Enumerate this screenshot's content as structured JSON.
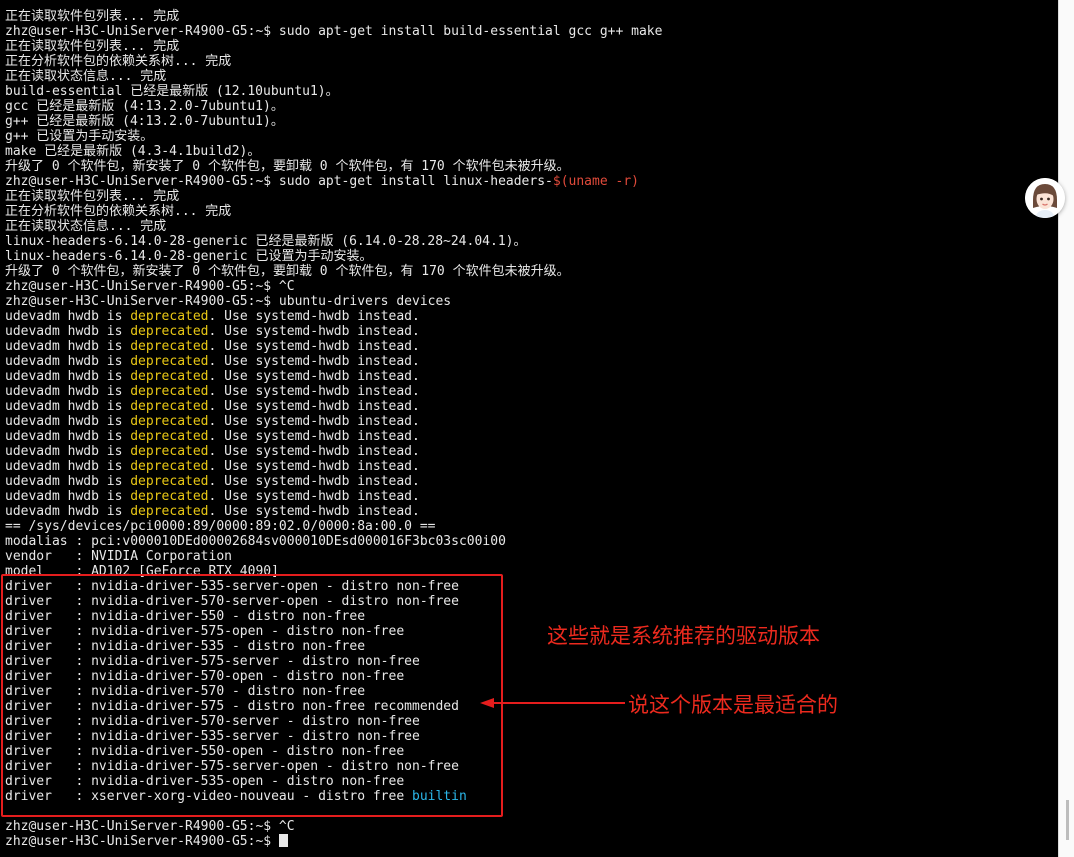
{
  "terminal": {
    "lines": [
      [
        {
          "t": "正在读取软件包列表... 完成",
          "c": "default"
        }
      ],
      [
        {
          "t": "zhz@user-H3C-UniServer-R4900-G5:~$ sudo apt-get install build-essential gcc g++ make",
          "c": "default"
        }
      ],
      [
        {
          "t": "正在读取软件包列表... 完成",
          "c": "default"
        }
      ],
      [
        {
          "t": "正在分析软件包的依赖关系树... 完成",
          "c": "default"
        }
      ],
      [
        {
          "t": "正在读取状态信息... 完成",
          "c": "default"
        }
      ],
      [
        {
          "t": "build-essential 已经是最新版 (12.10ubuntu1)。",
          "c": "default"
        }
      ],
      [
        {
          "t": "gcc 已经是最新版 (4:13.2.0-7ubuntu1)。",
          "c": "default"
        }
      ],
      [
        {
          "t": "g++ 已经是最新版 (4:13.2.0-7ubuntu1)。",
          "c": "default"
        }
      ],
      [
        {
          "t": "g++ 已设置为手动安装。",
          "c": "default"
        }
      ],
      [
        {
          "t": "make 已经是最新版 (4.3-4.1build2)。",
          "c": "default"
        }
      ],
      [
        {
          "t": "升级了 0 个软件包，新安装了 0 个软件包，要卸载 0 个软件包，有 170 个软件包未被升级。",
          "c": "default"
        }
      ],
      [
        {
          "t": "zhz@user-H3C-UniServer-R4900-G5:~$ sudo apt-get install linux-headers-",
          "c": "default"
        },
        {
          "t": "$(uname -r)",
          "c": "red"
        }
      ],
      [
        {
          "t": "正在读取软件包列表... 完成",
          "c": "default"
        }
      ],
      [
        {
          "t": "正在分析软件包的依赖关系树... 完成",
          "c": "default"
        }
      ],
      [
        {
          "t": "正在读取状态信息... 完成",
          "c": "default"
        }
      ],
      [
        {
          "t": "linux-headers-6.14.0-28-generic 已经是最新版 (6.14.0-28.28~24.04.1)。",
          "c": "default"
        }
      ],
      [
        {
          "t": "linux-headers-6.14.0-28-generic 已设置为手动安装。",
          "c": "default"
        }
      ],
      [
        {
          "t": "升级了 0 个软件包，新安装了 0 个软件包，要卸载 0 个软件包，有 170 个软件包未被升级。",
          "c": "default"
        }
      ],
      [
        {
          "t": "zhz@user-H3C-UniServer-R4900-G5:~$ ^C",
          "c": "default"
        }
      ],
      [
        {
          "t": "zhz@user-H3C-UniServer-R4900-G5:~$ ubuntu-drivers devices",
          "c": "default"
        }
      ],
      [
        {
          "t": "udevadm hwdb is ",
          "c": "default"
        },
        {
          "t": "deprecated",
          "c": "yellow"
        },
        {
          "t": ". Use systemd-hwdb instead.",
          "c": "default"
        }
      ],
      [
        {
          "t": "udevadm hwdb is ",
          "c": "default"
        },
        {
          "t": "deprecated",
          "c": "yellow"
        },
        {
          "t": ". Use systemd-hwdb instead.",
          "c": "default"
        }
      ],
      [
        {
          "t": "udevadm hwdb is ",
          "c": "default"
        },
        {
          "t": "deprecated",
          "c": "yellow"
        },
        {
          "t": ". Use systemd-hwdb instead.",
          "c": "default"
        }
      ],
      [
        {
          "t": "udevadm hwdb is ",
          "c": "default"
        },
        {
          "t": "deprecated",
          "c": "yellow"
        },
        {
          "t": ". Use systemd-hwdb instead.",
          "c": "default"
        }
      ],
      [
        {
          "t": "udevadm hwdb is ",
          "c": "default"
        },
        {
          "t": "deprecated",
          "c": "yellow"
        },
        {
          "t": ". Use systemd-hwdb instead.",
          "c": "default"
        }
      ],
      [
        {
          "t": "udevadm hwdb is ",
          "c": "default"
        },
        {
          "t": "deprecated",
          "c": "yellow"
        },
        {
          "t": ". Use systemd-hwdb instead.",
          "c": "default"
        }
      ],
      [
        {
          "t": "udevadm hwdb is ",
          "c": "default"
        },
        {
          "t": "deprecated",
          "c": "yellow"
        },
        {
          "t": ". Use systemd-hwdb instead.",
          "c": "default"
        }
      ],
      [
        {
          "t": "udevadm hwdb is ",
          "c": "default"
        },
        {
          "t": "deprecated",
          "c": "yellow"
        },
        {
          "t": ". Use systemd-hwdb instead.",
          "c": "default"
        }
      ],
      [
        {
          "t": "udevadm hwdb is ",
          "c": "default"
        },
        {
          "t": "deprecated",
          "c": "yellow"
        },
        {
          "t": ". Use systemd-hwdb instead.",
          "c": "default"
        }
      ],
      [
        {
          "t": "udevadm hwdb is ",
          "c": "default"
        },
        {
          "t": "deprecated",
          "c": "yellow"
        },
        {
          "t": ". Use systemd-hwdb instead.",
          "c": "default"
        }
      ],
      [
        {
          "t": "udevadm hwdb is ",
          "c": "default"
        },
        {
          "t": "deprecated",
          "c": "yellow"
        },
        {
          "t": ". Use systemd-hwdb instead.",
          "c": "default"
        }
      ],
      [
        {
          "t": "udevadm hwdb is ",
          "c": "default"
        },
        {
          "t": "deprecated",
          "c": "yellow"
        },
        {
          "t": ". Use systemd-hwdb instead.",
          "c": "default"
        }
      ],
      [
        {
          "t": "udevadm hwdb is ",
          "c": "default"
        },
        {
          "t": "deprecated",
          "c": "yellow"
        },
        {
          "t": ". Use systemd-hwdb instead.",
          "c": "default"
        }
      ],
      [
        {
          "t": "udevadm hwdb is ",
          "c": "default"
        },
        {
          "t": "deprecated",
          "c": "yellow"
        },
        {
          "t": ". Use systemd-hwdb instead.",
          "c": "default"
        }
      ],
      [
        {
          "t": "== /sys/devices/pci0000:89/0000:89:02.0/0000:8a:00.0 ==",
          "c": "default"
        }
      ],
      [
        {
          "t": "modalias : pci:v000010DEd00002684sv000010DEsd000016F3bc03sc00i00",
          "c": "default"
        }
      ],
      [
        {
          "t": "vendor   : NVIDIA Corporation",
          "c": "default"
        }
      ],
      [
        {
          "t": "model    : AD102 [GeForce RTX 4090]",
          "c": "default"
        }
      ],
      [
        {
          "t": "driver   : nvidia-driver-535-server-open - distro non-free",
          "c": "default"
        }
      ],
      [
        {
          "t": "driver   : nvidia-driver-570-server-open - distro non-free",
          "c": "default"
        }
      ],
      [
        {
          "t": "driver   : nvidia-driver-550 - distro non-free",
          "c": "default"
        }
      ],
      [
        {
          "t": "driver   : nvidia-driver-575-open - distro non-free",
          "c": "default"
        }
      ],
      [
        {
          "t": "driver   : nvidia-driver-535 - distro non-free",
          "c": "default"
        }
      ],
      [
        {
          "t": "driver   : nvidia-driver-575-server - distro non-free",
          "c": "default"
        }
      ],
      [
        {
          "t": "driver   : nvidia-driver-570-open - distro non-free",
          "c": "default"
        }
      ],
      [
        {
          "t": "driver   : nvidia-driver-570 - distro non-free",
          "c": "default"
        }
      ],
      [
        {
          "t": "driver   : nvidia-driver-575 - distro non-free recommended",
          "c": "default"
        }
      ],
      [
        {
          "t": "driver   : nvidia-driver-570-server - distro non-free",
          "c": "default"
        }
      ],
      [
        {
          "t": "driver   : nvidia-driver-535-server - distro non-free",
          "c": "default"
        }
      ],
      [
        {
          "t": "driver   : nvidia-driver-550-open - distro non-free",
          "c": "default"
        }
      ],
      [
        {
          "t": "driver   : nvidia-driver-575-server-open - distro non-free",
          "c": "default"
        }
      ],
      [
        {
          "t": "driver   : nvidia-driver-535-open - distro non-free",
          "c": "default"
        }
      ],
      [
        {
          "t": "driver   : xserver-xorg-video-nouveau - distro free ",
          "c": "default"
        },
        {
          "t": "builtin",
          "c": "cyan"
        }
      ],
      [
        {
          "t": "",
          "c": "default"
        }
      ],
      [
        {
          "t": "zhz@user-H3C-UniServer-R4900-G5:~$ ^C",
          "c": "default"
        }
      ],
      [
        {
          "t": "zhz@user-H3C-UniServer-R4900-G5:~$ ",
          "c": "default"
        }
      ]
    ],
    "cursor_line": 55
  },
  "annotations": {
    "note_recommended_list": "这些就是系统推荐的驱动版本",
    "note_best_fit": "说这个版本是最适合的"
  },
  "colors": {
    "background": "#000000",
    "text": "#e8e8e8",
    "warning_yellow": "#e9c815",
    "command_red": "#e04a3a",
    "builtin_cyan": "#2bb7ea",
    "annotation_red": "#e51d1d"
  }
}
